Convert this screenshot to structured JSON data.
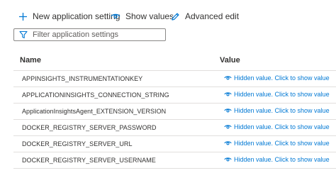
{
  "toolbar": {
    "new_setting_label": "New application setting",
    "show_values_label": "Show values",
    "advanced_edit_label": "Advanced edit",
    "new_icon": "plus-icon",
    "show_icon": "eye-icon",
    "edit_icon": "pencil-icon"
  },
  "filter": {
    "placeholder": "Filter application settings",
    "value": "",
    "icon": "filter-icon"
  },
  "table": {
    "headers": {
      "name": "Name",
      "value": "Value"
    },
    "rows": [
      {
        "name": "APPINSIGHTS_INSTRUMENTATIONKEY",
        "value": "Hidden value. Click to show value"
      },
      {
        "name": "APPLICATIONINSIGHTS_CONNECTION_STRING",
        "value": "Hidden value. Click to show value"
      },
      {
        "name": "ApplicationInsightsAgent_EXTENSION_VERSION",
        "value": "Hidden value. Click to show value"
      },
      {
        "name": "DOCKER_REGISTRY_SERVER_PASSWORD",
        "value": "Hidden value. Click to show value"
      },
      {
        "name": "DOCKER_REGISTRY_SERVER_URL",
        "value": "Hidden value. Click to show value"
      },
      {
        "name": "DOCKER_REGISTRY_SERVER_USERNAME",
        "value": "Hidden value. Click to show value"
      }
    ]
  },
  "colors": {
    "accent": "#0078d4",
    "text": "#323130",
    "border": "#e1dfdd"
  }
}
